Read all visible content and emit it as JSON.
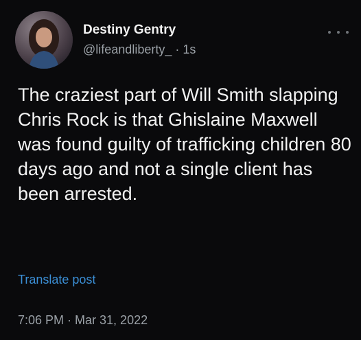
{
  "post": {
    "author": {
      "display_name": "Destiny Gentry",
      "handle": "@lifeandliberty_",
      "age": "1s",
      "meta_line": "@lifeandliberty_ · 1s"
    },
    "text": "The craziest part of Will Smith slapping Chris Rock is that Ghislaine Maxwell was found guilty of trafficking children 80 days ago and not a single client has been arrested.",
    "translate_label": "Translate post",
    "timestamp": "7:06 PM · Mar 31, 2022"
  },
  "icons": {
    "more": "more-horizontal-icon"
  },
  "colors": {
    "background": "#0a0a0c",
    "text": "#f2f2f2",
    "secondary_text": "#9aa0a6",
    "link": "#3b8fd6"
  }
}
